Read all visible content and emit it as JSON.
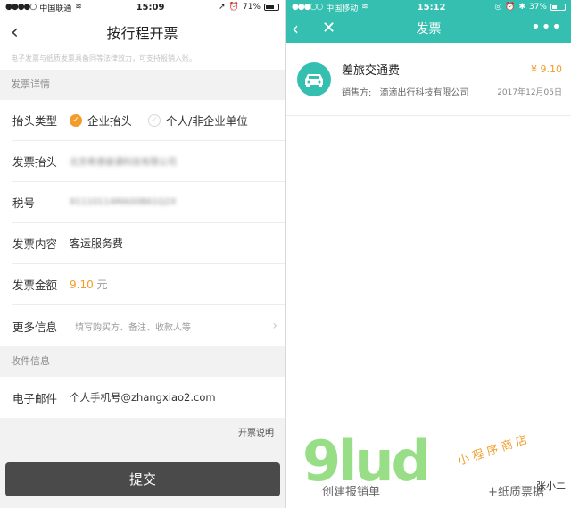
{
  "left": {
    "status": {
      "carrier": "中国联通",
      "time": "15:09",
      "battery": "71%",
      "battery_level": 0.71
    },
    "nav": {
      "title": "按行程开票"
    },
    "notice": "电子发票与纸质发票具备同等法律效力，可支持报销入账。",
    "section_invoice": "发票详情",
    "rows": {
      "header_type": {
        "label": "抬头类型",
        "opt1": "企业抬头",
        "opt2": "个人/非企业单位"
      },
      "header": {
        "label": "发票抬头",
        "value": "北京希德彼通科技有限公司"
      },
      "tax": {
        "label": "税号",
        "value": "91110114MA00B61Q2X"
      },
      "content": {
        "label": "发票内容",
        "value": "客运服务费"
      },
      "amount": {
        "label": "发票金额",
        "value": "9.10",
        "unit": "元"
      },
      "more": {
        "label": "更多信息",
        "hint": "填写购买方、备注、收款人等"
      }
    },
    "section_receive": "收件信息",
    "email": {
      "label": "电子邮件",
      "value": "个人手机号@zhangxiao2.com"
    },
    "instructions": "开票说明",
    "submit": "提交"
  },
  "right": {
    "status": {
      "carrier": "中国移动",
      "time": "15:12",
      "battery": "37%",
      "battery_level": 0.37
    },
    "nav": {
      "title": "发票"
    },
    "invoice": {
      "name": "差旅交通费",
      "amount": "¥ 9.10",
      "seller_label": "销售方:",
      "seller": "滴滴出行科技有限公司",
      "date": "2017年12月05日"
    },
    "bottom": {
      "create": "创建报销单",
      "add": "+纸质票据"
    },
    "watermark": {
      "logo": "9lud",
      "cn": "小程序商店",
      "small": "张小二"
    }
  },
  "colors": {
    "accent": "#f39c2c",
    "teal": "#35bfb0",
    "submit": "#4a4a4a"
  }
}
